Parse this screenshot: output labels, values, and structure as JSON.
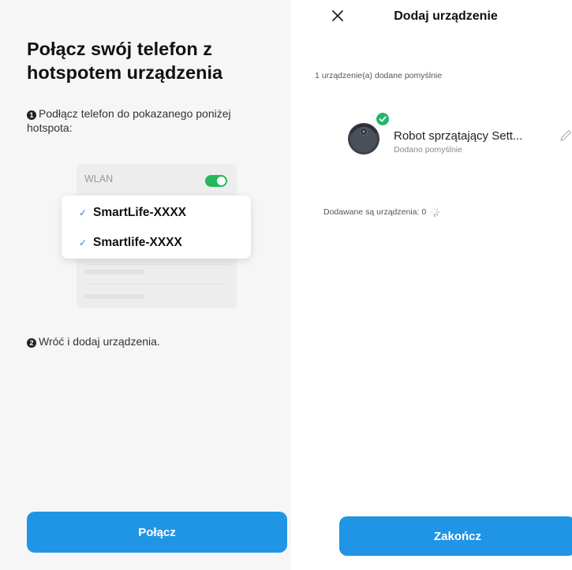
{
  "left": {
    "title": "Połącz swój telefon z hotspotem urządzenia",
    "step1_num": "1",
    "step1_text": "Podłącz telefon do pokazanego poniżej hotspota:",
    "wlan_label": "WLAN",
    "wlan_enabled": true,
    "ssids": [
      "SmartLife-XXXX",
      "Smartlife-XXXX"
    ],
    "step2_num": "2",
    "step2_text": "Wróć i dodaj urządzenia.",
    "connect_button": "Połącz"
  },
  "right": {
    "title": "Dodaj urządzenie",
    "added_summary": "1 urządzenie(a) dodane pomyślnie",
    "device": {
      "name": "Robot sprzątający Sett...",
      "status": "Dodano pomyślnie",
      "icon": "robot-vacuum-icon"
    },
    "adding_status": "Dodawane są urządzenia: 0",
    "finish_button": "Zakończ"
  },
  "colors": {
    "accent": "#2095e6",
    "success": "#25b66c",
    "toggle_on": "#26b75a",
    "check": "#2d7de0",
    "left_bg": "#f6f6f6"
  }
}
